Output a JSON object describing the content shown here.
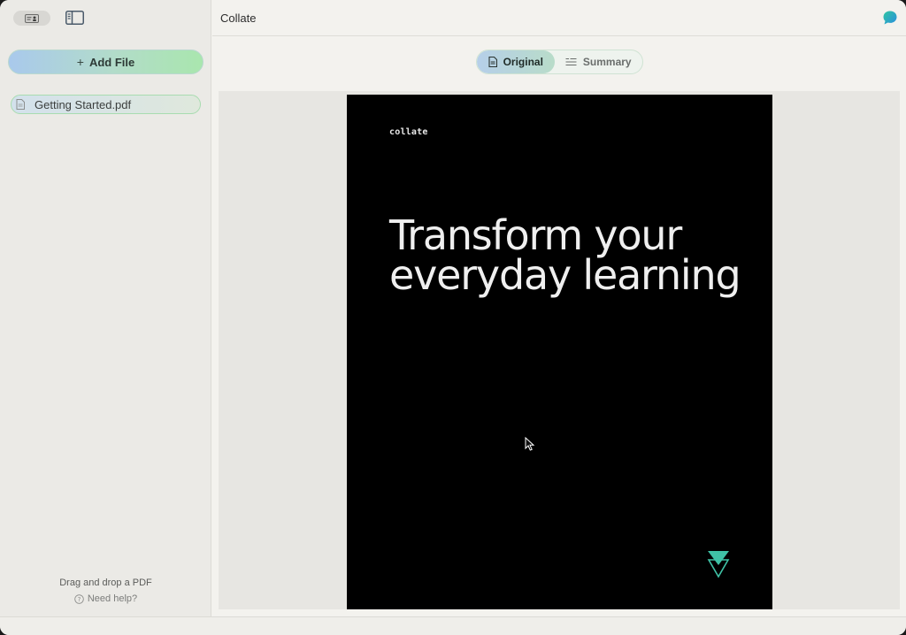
{
  "window": {
    "title": "Collate"
  },
  "sidebar": {
    "add_file_label": "Add File",
    "files": [
      {
        "name": "Getting Started.pdf"
      }
    ],
    "drop_hint": "Drag and drop a PDF",
    "help_label": "Need help?"
  },
  "view_switch": {
    "original_label": "Original",
    "summary_label": "Summary",
    "selected": "Original"
  },
  "document": {
    "brand": "collate",
    "headline": "Transform your everyday learning"
  },
  "colors": {
    "accent_blue": "#a9c9ec",
    "accent_green": "#a9e6ae",
    "page_bg": "#000000",
    "logo_teal": "#3fc2a6"
  },
  "icons": {
    "sidebar_toggle": "id-card-icon",
    "panel": "sidebar-panel-icon",
    "add": "plus-icon",
    "file": "document-icon",
    "help": "question-circle-icon",
    "chat": "chat-bubble-icon",
    "original": "document-icon",
    "summary": "list-icon"
  }
}
